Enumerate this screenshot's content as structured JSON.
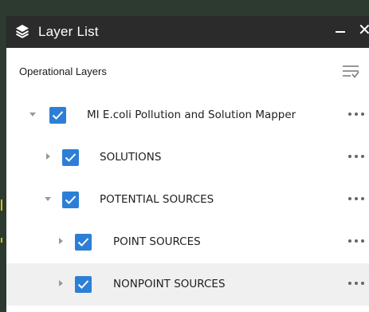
{
  "panel": {
    "title": "Layer List",
    "icon": "layers-icon",
    "colors": {
      "header_bg": "#2b2b2b",
      "checkbox": "#2d7fd6",
      "highlight_row": "#f0f0f0"
    }
  },
  "subheader": {
    "label": "Operational Layers",
    "filter_icon": "filter-icon"
  },
  "layers": [
    {
      "name": "MI E.coli Pollution and Solution Mapper",
      "expanded": true,
      "checked": true,
      "level": 0
    },
    {
      "name": "SOLUTIONS",
      "expanded": false,
      "checked": true,
      "level": 1
    },
    {
      "name": "POTENTIAL SOURCES",
      "expanded": true,
      "checked": true,
      "level": 1
    },
    {
      "name": "POINT SOURCES",
      "expanded": false,
      "checked": true,
      "level": 2
    },
    {
      "name": "NONPOINT SOURCES",
      "expanded": false,
      "checked": true,
      "level": 2,
      "highlighted": true
    }
  ]
}
